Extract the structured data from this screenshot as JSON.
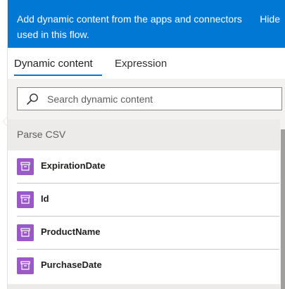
{
  "banner": {
    "text": "Add dynamic content from the apps and connectors used in this flow.",
    "hide_label": "Hide"
  },
  "tabs": [
    {
      "label": "Dynamic content",
      "active": true
    },
    {
      "label": "Expression",
      "active": false
    }
  ],
  "search": {
    "placeholder": "Search dynamic content"
  },
  "section": {
    "title": "Parse CSV"
  },
  "items": [
    {
      "label": "ExpirationDate",
      "icon": "data-operation-icon"
    },
    {
      "label": "Id",
      "icon": "data-operation-icon"
    },
    {
      "label": "ProductName",
      "icon": "data-operation-icon"
    },
    {
      "label": "PurchaseDate",
      "icon": "data-operation-icon"
    }
  ],
  "colors": {
    "accent": "#0078d4",
    "item_icon": "#9b59c7"
  }
}
